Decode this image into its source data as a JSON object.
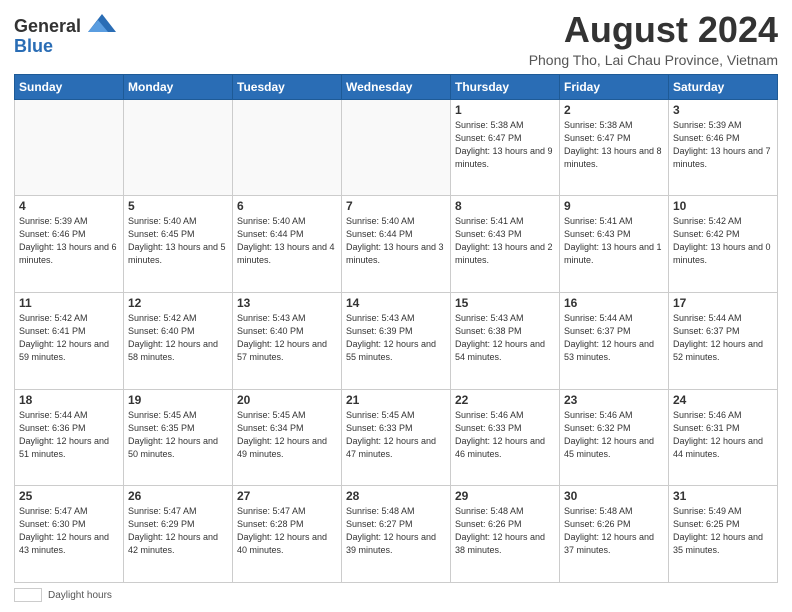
{
  "logo": {
    "general": "General",
    "blue": "Blue"
  },
  "title": "August 2024",
  "subtitle": "Phong Tho, Lai Chau Province, Vietnam",
  "days_of_week": [
    "Sunday",
    "Monday",
    "Tuesday",
    "Wednesday",
    "Thursday",
    "Friday",
    "Saturday"
  ],
  "footer": {
    "label": "Daylight hours"
  },
  "weeks": [
    [
      {
        "day": "",
        "info": ""
      },
      {
        "day": "",
        "info": ""
      },
      {
        "day": "",
        "info": ""
      },
      {
        "day": "",
        "info": ""
      },
      {
        "day": "1",
        "info": "Sunrise: 5:38 AM\nSunset: 6:47 PM\nDaylight: 13 hours\nand 9 minutes."
      },
      {
        "day": "2",
        "info": "Sunrise: 5:38 AM\nSunset: 6:47 PM\nDaylight: 13 hours\nand 8 minutes."
      },
      {
        "day": "3",
        "info": "Sunrise: 5:39 AM\nSunset: 6:46 PM\nDaylight: 13 hours\nand 7 minutes."
      }
    ],
    [
      {
        "day": "4",
        "info": "Sunrise: 5:39 AM\nSunset: 6:46 PM\nDaylight: 13 hours\nand 6 minutes."
      },
      {
        "day": "5",
        "info": "Sunrise: 5:40 AM\nSunset: 6:45 PM\nDaylight: 13 hours\nand 5 minutes."
      },
      {
        "day": "6",
        "info": "Sunrise: 5:40 AM\nSunset: 6:44 PM\nDaylight: 13 hours\nand 4 minutes."
      },
      {
        "day": "7",
        "info": "Sunrise: 5:40 AM\nSunset: 6:44 PM\nDaylight: 13 hours\nand 3 minutes."
      },
      {
        "day": "8",
        "info": "Sunrise: 5:41 AM\nSunset: 6:43 PM\nDaylight: 13 hours\nand 2 minutes."
      },
      {
        "day": "9",
        "info": "Sunrise: 5:41 AM\nSunset: 6:43 PM\nDaylight: 13 hours\nand 1 minute."
      },
      {
        "day": "10",
        "info": "Sunrise: 5:42 AM\nSunset: 6:42 PM\nDaylight: 13 hours\nand 0 minutes."
      }
    ],
    [
      {
        "day": "11",
        "info": "Sunrise: 5:42 AM\nSunset: 6:41 PM\nDaylight: 12 hours\nand 59 minutes."
      },
      {
        "day": "12",
        "info": "Sunrise: 5:42 AM\nSunset: 6:40 PM\nDaylight: 12 hours\nand 58 minutes."
      },
      {
        "day": "13",
        "info": "Sunrise: 5:43 AM\nSunset: 6:40 PM\nDaylight: 12 hours\nand 57 minutes."
      },
      {
        "day": "14",
        "info": "Sunrise: 5:43 AM\nSunset: 6:39 PM\nDaylight: 12 hours\nand 55 minutes."
      },
      {
        "day": "15",
        "info": "Sunrise: 5:43 AM\nSunset: 6:38 PM\nDaylight: 12 hours\nand 54 minutes."
      },
      {
        "day": "16",
        "info": "Sunrise: 5:44 AM\nSunset: 6:37 PM\nDaylight: 12 hours\nand 53 minutes."
      },
      {
        "day": "17",
        "info": "Sunrise: 5:44 AM\nSunset: 6:37 PM\nDaylight: 12 hours\nand 52 minutes."
      }
    ],
    [
      {
        "day": "18",
        "info": "Sunrise: 5:44 AM\nSunset: 6:36 PM\nDaylight: 12 hours\nand 51 minutes."
      },
      {
        "day": "19",
        "info": "Sunrise: 5:45 AM\nSunset: 6:35 PM\nDaylight: 12 hours\nand 50 minutes."
      },
      {
        "day": "20",
        "info": "Sunrise: 5:45 AM\nSunset: 6:34 PM\nDaylight: 12 hours\nand 49 minutes."
      },
      {
        "day": "21",
        "info": "Sunrise: 5:45 AM\nSunset: 6:33 PM\nDaylight: 12 hours\nand 47 minutes."
      },
      {
        "day": "22",
        "info": "Sunrise: 5:46 AM\nSunset: 6:33 PM\nDaylight: 12 hours\nand 46 minutes."
      },
      {
        "day": "23",
        "info": "Sunrise: 5:46 AM\nSunset: 6:32 PM\nDaylight: 12 hours\nand 45 minutes."
      },
      {
        "day": "24",
        "info": "Sunrise: 5:46 AM\nSunset: 6:31 PM\nDaylight: 12 hours\nand 44 minutes."
      }
    ],
    [
      {
        "day": "25",
        "info": "Sunrise: 5:47 AM\nSunset: 6:30 PM\nDaylight: 12 hours\nand 43 minutes."
      },
      {
        "day": "26",
        "info": "Sunrise: 5:47 AM\nSunset: 6:29 PM\nDaylight: 12 hours\nand 42 minutes."
      },
      {
        "day": "27",
        "info": "Sunrise: 5:47 AM\nSunset: 6:28 PM\nDaylight: 12 hours\nand 40 minutes."
      },
      {
        "day": "28",
        "info": "Sunrise: 5:48 AM\nSunset: 6:27 PM\nDaylight: 12 hours\nand 39 minutes."
      },
      {
        "day": "29",
        "info": "Sunrise: 5:48 AM\nSunset: 6:26 PM\nDaylight: 12 hours\nand 38 minutes."
      },
      {
        "day": "30",
        "info": "Sunrise: 5:48 AM\nSunset: 6:26 PM\nDaylight: 12 hours\nand 37 minutes."
      },
      {
        "day": "31",
        "info": "Sunrise: 5:49 AM\nSunset: 6:25 PM\nDaylight: 12 hours\nand 35 minutes."
      }
    ]
  ]
}
